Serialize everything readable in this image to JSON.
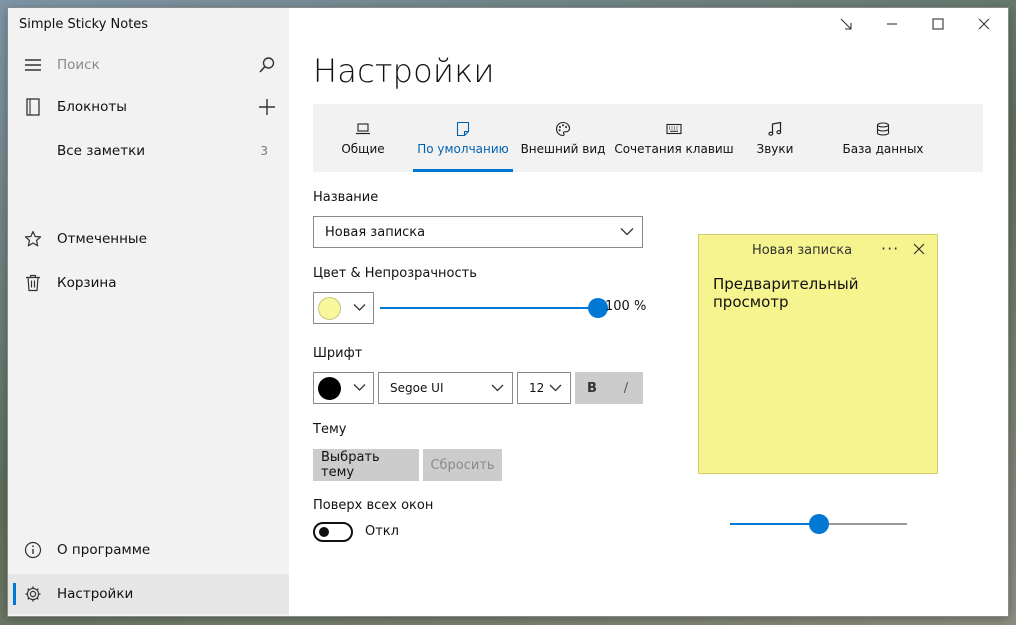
{
  "app": {
    "title": "Simple Sticky Notes"
  },
  "sidebar": {
    "search_placeholder": "Поиск",
    "notebooks_label": "Блокноты",
    "all_notes_label": "Все заметки",
    "all_notes_count": "3",
    "starred_label": "Отмеченные",
    "trash_label": "Корзина",
    "about_label": "О программе",
    "settings_label": "Настройки"
  },
  "page": {
    "title": "Настройки"
  },
  "tabs": [
    {
      "label": "Общие",
      "icon": "laptop-icon"
    },
    {
      "label": "По умолчанию",
      "icon": "note-icon"
    },
    {
      "label": "Внешний вид",
      "icon": "palette-icon"
    },
    {
      "label": "Сочетания клавиш",
      "icon": "keyboard-icon"
    },
    {
      "label": "Звуки",
      "icon": "music-icon"
    },
    {
      "label": "База данных",
      "icon": "database-icon"
    }
  ],
  "form": {
    "name_label": "Название",
    "name_value": "Новая записка",
    "color_label": "Цвет & Непрозрачность",
    "color_value": "#f9f79c",
    "opacity_text": "100 %",
    "opacity_percent": 100,
    "font_label": "Шрифт",
    "font_color": "#000000",
    "font_family": "Segoe UI",
    "font_size": "12",
    "bold_label": "B",
    "italic_label": "/",
    "theme_label": "Тему",
    "choose_theme_label": "Выбрать тему",
    "reset_label": "Сбросить",
    "ontop_label": "Поверх всех окон",
    "ontop_state": "Откл"
  },
  "preview": {
    "title": "Новая записка",
    "body": "Предварительный просмотр",
    "more": "···",
    "size_percent": 50
  },
  "colors": {
    "accent": "#0078d4",
    "note_yellow": "#f6f48e"
  }
}
